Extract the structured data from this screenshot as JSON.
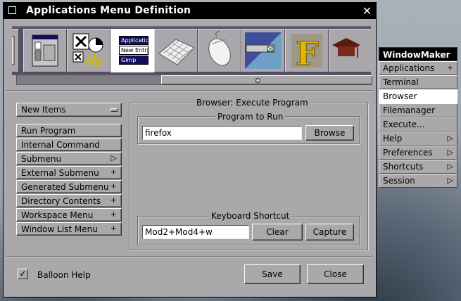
{
  "window": {
    "title": "Applications Menu Definition",
    "close": "✕"
  },
  "icons": {
    "selected_lines": [
      "Applicatio",
      "New Entr|",
      "Gimp"
    ]
  },
  "new_items": {
    "label": "New Items"
  },
  "commands": [
    {
      "label": "Run Program",
      "mark": ""
    },
    {
      "label": "Internal Command",
      "mark": ""
    },
    {
      "label": "Submenu",
      "mark": "▷"
    },
    {
      "label": "External Submenu",
      "mark": "+"
    },
    {
      "label": "Generated Submenu",
      "mark": "+"
    },
    {
      "label": "Directory Contents",
      "mark": "+"
    },
    {
      "label": "Workspace Menu",
      "mark": "+"
    },
    {
      "label": "Window List Menu",
      "mark": "+"
    }
  ],
  "editor": {
    "title": "Browser: Execute Program",
    "program_legend": "Program to Run",
    "program_value": "firefox",
    "browse_label": "Browse",
    "shortcut_legend": "Keyboard Shortcut",
    "shortcut_value": "Mod2+Mod4+w",
    "clear_label": "Clear",
    "capture_label": "Capture"
  },
  "footer": {
    "balloon_check": "✓",
    "balloon_label": "Balloon Help",
    "save_label": "Save",
    "close_label": "Close"
  },
  "wm_menu": {
    "title": "WindowMaker",
    "items": [
      {
        "label": "Applications",
        "mark": "+"
      },
      {
        "label": "Terminal",
        "mark": ""
      },
      {
        "label": "Browser",
        "mark": ""
      },
      {
        "label": "Filemanager",
        "mark": ""
      },
      {
        "label": "Execute...",
        "mark": ""
      },
      {
        "label": "Help",
        "mark": "▷"
      },
      {
        "label": "Preferences",
        "mark": "▷"
      },
      {
        "label": "Shortcuts",
        "mark": "▷"
      },
      {
        "label": "Session",
        "mark": "▷"
      }
    ]
  }
}
